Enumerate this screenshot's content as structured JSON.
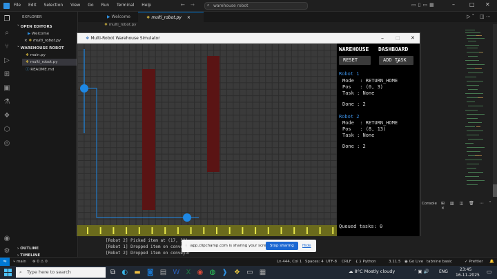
{
  "menu": [
    "File",
    "Edit",
    "Selection",
    "View",
    "Go",
    "Run",
    "Terminal",
    "Help"
  ],
  "search_text": "warehouse robot",
  "explorer": {
    "title": "EXPLORER",
    "open_editors": "OPEN EDITORS",
    "open_files": [
      "Welcome",
      "multi_robot.py"
    ],
    "project": "WAREHOUSE ROBOT",
    "files": [
      "main.py",
      "multi_robot.py",
      "README.md"
    ],
    "outline": "OUTLINE",
    "timeline": "TIMELINE"
  },
  "tabs": {
    "welcome": "Welcome",
    "active": "multi_robot.py"
  },
  "breadcrumb": "multi_robot.py",
  "simulator": {
    "title": "Multi-Robot Warehouse Simulator",
    "dashboard_left": "WAREHOUSE",
    "dashboard_right": "DASHBOARD",
    "reset_label": "RESET",
    "add_task_label": "ADD TASK",
    "robots": [
      {
        "name": "Robot 1",
        "mode": "Mode  : RETURN_HOME",
        "pos": "Pos   : (0, 3)",
        "task": "Task : None",
        "done": "Done : 2"
      },
      {
        "name": "Robot 2",
        "mode": "Mode  : RETURN_HOME",
        "pos": "Pos   : (8, 13)",
        "task": "Task : None",
        "done": "Done : 2"
      }
    ],
    "queued": "Queued tasks: 0",
    "colors": {
      "robot": "#1e88e5",
      "shelf": "#5a1414",
      "conveyor": "#6b6b1c",
      "marker": "#e6e64a",
      "title_blue": "#3b8de0"
    }
  },
  "console_lines": [
    "[Robot 2] Picked item at (17, 11)",
    "[Robot 1] Dropped item on conveyor",
    "[Robot 2] Dropped item on conveyor"
  ],
  "share_bar": {
    "text": "app.clipchamp.com is sharing your screen.",
    "stop": "Stop sharing",
    "hide": "Hide"
  },
  "console_panel": {
    "label": "Console"
  },
  "status": {
    "branch": "main",
    "errors": "0",
    "warnings": "0",
    "position": "Ln 444, Col 1",
    "spaces": "Spaces: 4",
    "encoding": "UTF-8",
    "eol": "CRLF",
    "language": "Python",
    "version": "3.11.5",
    "golive": "Go Live",
    "tabnine": "tabnine basic",
    "prettier": "Prettier"
  },
  "taskbar": {
    "search": "Type here to search",
    "weather": "8°C  Mostly cloudy",
    "lang": "ENG",
    "time": "23:45",
    "date": "16-11-2025"
  }
}
